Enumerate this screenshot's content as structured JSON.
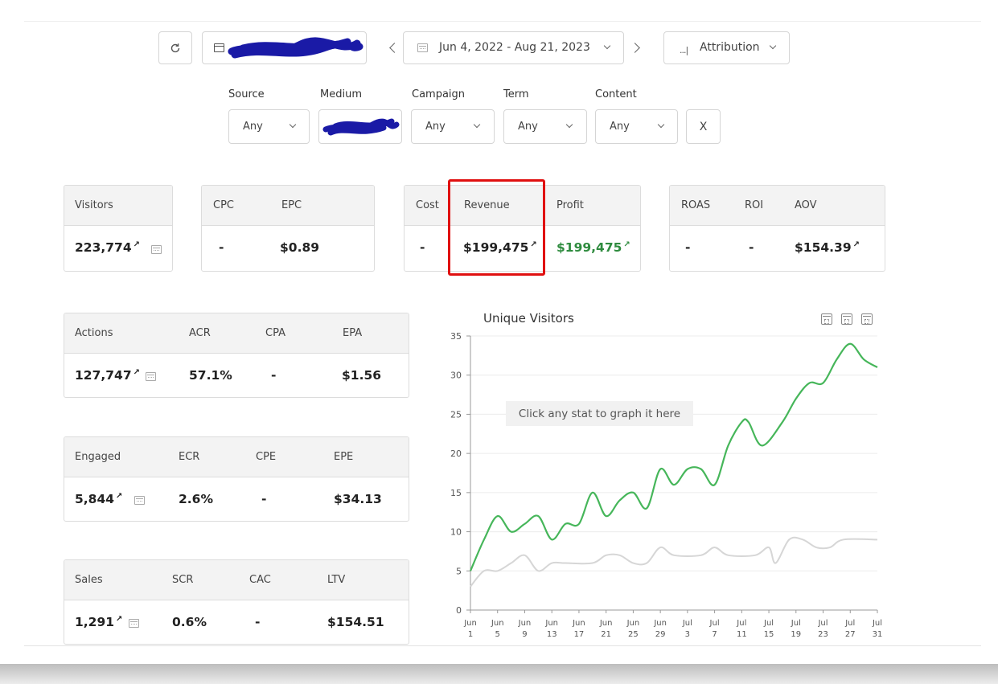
{
  "toolbar": {
    "refresh_icon": "refresh-icon",
    "date_range": "Jun 4, 2022 - Aug 21, 2023",
    "attribution_label": "Attribution"
  },
  "filters": {
    "labels": {
      "source": "Source",
      "medium": "Medium",
      "campaign": "Campaign",
      "term": "Term",
      "content": "Content"
    },
    "values": {
      "source": "Any",
      "campaign": "Any",
      "term": "Any",
      "content": "Any"
    },
    "clear_label": "X"
  },
  "stats": {
    "visitors": {
      "label": "Visitors",
      "value": "223,774"
    },
    "cpc": {
      "label": "CPC",
      "value": "-"
    },
    "epc": {
      "label": "EPC",
      "value": "$0.89"
    },
    "cost": {
      "label": "Cost",
      "value": "-"
    },
    "revenue": {
      "label": "Revenue",
      "value": "$199,475"
    },
    "profit": {
      "label": "Profit",
      "value": "$199,475"
    },
    "roas": {
      "label": "ROAS",
      "value": "-"
    },
    "roi": {
      "label": "ROI",
      "value": "-"
    },
    "aov": {
      "label": "AOV",
      "value": "$154.39"
    },
    "actions": {
      "label": "Actions",
      "value": "127,747"
    },
    "acr": {
      "label": "ACR",
      "value": "57.1%"
    },
    "cpa": {
      "label": "CPA",
      "value": "-"
    },
    "epa": {
      "label": "EPA",
      "value": "$1.56"
    },
    "engaged": {
      "label": "Engaged",
      "value": "5,844"
    },
    "ecr": {
      "label": "ECR",
      "value": "2.6%"
    },
    "cpe": {
      "label": "CPE",
      "value": "-"
    },
    "epe": {
      "label": "EPE",
      "value": "$34.13"
    },
    "sales": {
      "label": "Sales",
      "value": "1,291"
    },
    "scr": {
      "label": "SCR",
      "value": "0.6%"
    },
    "cac": {
      "label": "CAC",
      "value": "-"
    },
    "ltv": {
      "label": "LTV",
      "value": "$154.51"
    },
    "trend_glyph": "↗",
    "colors": {
      "profit_green": "#2e8b3e",
      "highlight_red": "#e01010"
    }
  },
  "chart_data": {
    "type": "line",
    "title": "Unique Visitors",
    "tooltip": "Click any stat to graph it here",
    "ylim": [
      0,
      35
    ],
    "yticks": [
      0,
      5,
      10,
      15,
      20,
      25,
      30,
      35
    ],
    "xlim": [
      0,
      60
    ],
    "xticks": [
      {
        "x": 0,
        "line1": "Jun",
        "line2": "1"
      },
      {
        "x": 4,
        "line1": "Jun",
        "line2": "5"
      },
      {
        "x": 8,
        "line1": "Jun",
        "line2": "9"
      },
      {
        "x": 12,
        "line1": "Jun",
        "line2": "13"
      },
      {
        "x": 16,
        "line1": "Jun",
        "line2": "17"
      },
      {
        "x": 20,
        "line1": "Jun",
        "line2": "21"
      },
      {
        "x": 24,
        "line1": "Jun",
        "line2": "25"
      },
      {
        "x": 28,
        "line1": "Jun",
        "line2": "29"
      },
      {
        "x": 32,
        "line1": "Jul",
        "line2": "3"
      },
      {
        "x": 36,
        "line1": "Jul",
        "line2": "7"
      },
      {
        "x": 40,
        "line1": "Jul",
        "line2": "11"
      },
      {
        "x": 44,
        "line1": "Jul",
        "line2": "15"
      },
      {
        "x": 48,
        "line1": "Jul",
        "line2": "19"
      },
      {
        "x": 52,
        "line1": "Jul",
        "line2": "23"
      },
      {
        "x": 56,
        "line1": "Jul",
        "line2": "27"
      },
      {
        "x": 60,
        "line1": "Jul",
        "line2": "31"
      }
    ],
    "grid": true,
    "series": [
      {
        "color": "#46b65a",
        "points": [
          [
            0,
            5
          ],
          [
            2,
            9
          ],
          [
            4,
            12
          ],
          [
            6,
            10
          ],
          [
            8,
            11
          ],
          [
            10,
            12
          ],
          [
            12,
            9
          ],
          [
            14,
            11
          ],
          [
            16,
            11
          ],
          [
            18,
            15
          ],
          [
            20,
            12
          ],
          [
            22,
            14
          ],
          [
            24,
            15
          ],
          [
            26,
            13
          ],
          [
            28,
            18
          ],
          [
            30,
            16
          ],
          [
            32,
            18
          ],
          [
            34,
            18
          ],
          [
            36,
            16
          ],
          [
            38,
            21
          ],
          [
            40,
            24
          ],
          [
            41,
            24
          ],
          [
            43,
            21
          ],
          [
            46,
            24
          ],
          [
            48,
            27
          ],
          [
            50,
            29
          ],
          [
            52,
            29
          ],
          [
            54,
            32
          ],
          [
            56,
            34
          ],
          [
            58,
            32
          ],
          [
            60,
            31
          ]
        ]
      },
      {
        "color": "#d6d6d6",
        "points": [
          [
            0,
            3
          ],
          [
            2,
            5
          ],
          [
            4,
            5
          ],
          [
            6,
            6
          ],
          [
            8,
            7
          ],
          [
            10,
            5
          ],
          [
            12,
            6
          ],
          [
            14,
            6
          ],
          [
            18,
            6
          ],
          [
            20,
            7
          ],
          [
            22,
            7
          ],
          [
            24,
            6
          ],
          [
            26,
            6
          ],
          [
            28,
            8
          ],
          [
            30,
            7
          ],
          [
            34,
            7
          ],
          [
            36,
            8
          ],
          [
            38,
            7
          ],
          [
            42,
            7
          ],
          [
            44,
            8
          ],
          [
            45,
            6
          ],
          [
            47,
            9
          ],
          [
            49,
            9
          ],
          [
            51,
            8
          ],
          [
            53,
            8
          ],
          [
            55,
            9
          ],
          [
            60,
            9
          ]
        ]
      }
    ]
  }
}
